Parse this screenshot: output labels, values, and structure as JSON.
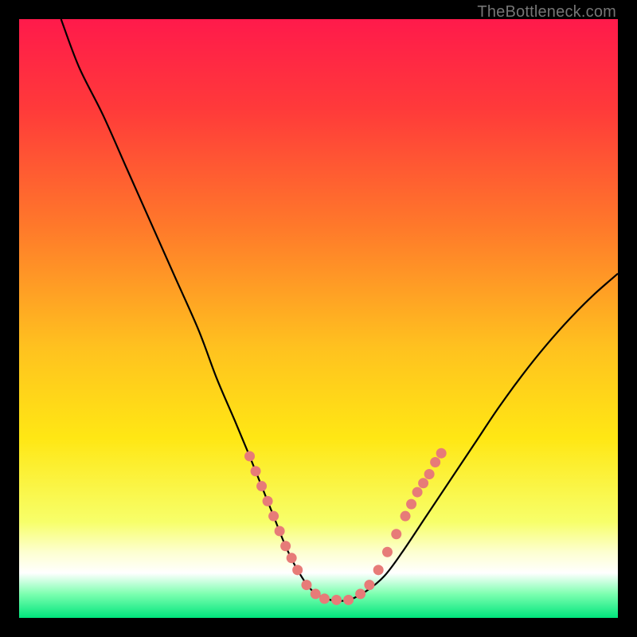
{
  "watermark": "TheBottleneck.com",
  "chart_data": {
    "type": "line",
    "title": "",
    "xlabel": "",
    "ylabel": "",
    "xlim": [
      0,
      100
    ],
    "ylim": [
      0,
      100
    ],
    "gradient_stops": [
      {
        "offset": 0.0,
        "color": "#ff1a4b"
      },
      {
        "offset": 0.15,
        "color": "#ff3a3a"
      },
      {
        "offset": 0.35,
        "color": "#ff7a2a"
      },
      {
        "offset": 0.55,
        "color": "#ffc21f"
      },
      {
        "offset": 0.7,
        "color": "#ffe714"
      },
      {
        "offset": 0.84,
        "color": "#f7ff6a"
      },
      {
        "offset": 0.89,
        "color": "#fdffd0"
      },
      {
        "offset": 0.925,
        "color": "#ffffff"
      },
      {
        "offset": 0.96,
        "color": "#7dffb0"
      },
      {
        "offset": 1.0,
        "color": "#00e57c"
      }
    ],
    "series": [
      {
        "name": "curve",
        "x": [
          7,
          10,
          14,
          18,
          22,
          26,
          30,
          33,
          36,
          38.5,
          40.5,
          42.5,
          44.5,
          46.5,
          49,
          52,
          55,
          58,
          61,
          64,
          68,
          72,
          76,
          80,
          84,
          88,
          92,
          96,
          100
        ],
        "y": [
          100,
          92,
          84,
          75,
          66,
          57,
          48,
          40,
          33,
          27,
          22,
          17,
          12,
          8,
          4.5,
          3,
          3,
          4.5,
          7,
          11,
          17,
          23,
          29,
          35,
          40.5,
          45.5,
          50,
          54,
          57.5
        ]
      }
    ],
    "markers": [
      {
        "x": 38.5,
        "y": 27
      },
      {
        "x": 39.5,
        "y": 24.5
      },
      {
        "x": 40.5,
        "y": 22
      },
      {
        "x": 41.5,
        "y": 19.5
      },
      {
        "x": 42.5,
        "y": 17
      },
      {
        "x": 43.5,
        "y": 14.5
      },
      {
        "x": 44.5,
        "y": 12
      },
      {
        "x": 45.5,
        "y": 10
      },
      {
        "x": 46.5,
        "y": 8
      },
      {
        "x": 48,
        "y": 5.5
      },
      {
        "x": 49.5,
        "y": 4
      },
      {
        "x": 51,
        "y": 3.2
      },
      {
        "x": 53,
        "y": 3
      },
      {
        "x": 55,
        "y": 3
      },
      {
        "x": 57,
        "y": 4
      },
      {
        "x": 58.5,
        "y": 5.5
      },
      {
        "x": 60,
        "y": 8
      },
      {
        "x": 61.5,
        "y": 11
      },
      {
        "x": 63,
        "y": 14
      },
      {
        "x": 64.5,
        "y": 17
      },
      {
        "x": 65.5,
        "y": 19
      },
      {
        "x": 66.5,
        "y": 21
      },
      {
        "x": 67.5,
        "y": 22.5
      },
      {
        "x": 68.5,
        "y": 24
      },
      {
        "x": 69.5,
        "y": 26
      },
      {
        "x": 70.5,
        "y": 27.5
      }
    ],
    "marker_style": {
      "radius_px": 6.5,
      "fill": "#e77b78",
      "stroke": "#000000",
      "stroke_width": 0
    },
    "curve_style": {
      "stroke": "#000000",
      "stroke_width": 2.2
    }
  }
}
